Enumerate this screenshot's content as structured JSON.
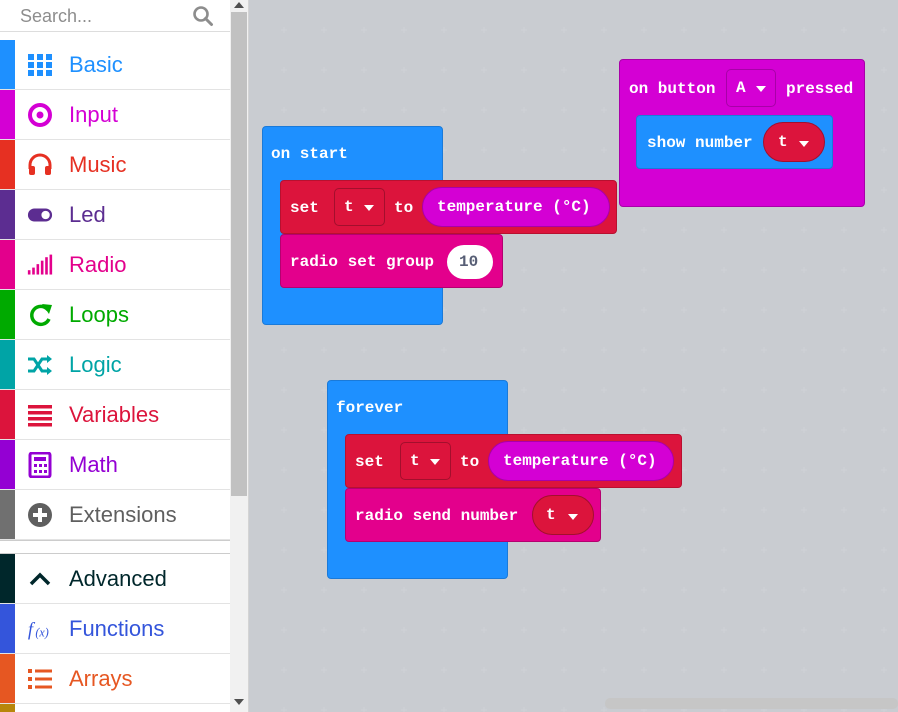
{
  "search": {
    "placeholder": "Search..."
  },
  "categories": [
    {
      "label": "Basic",
      "color": "#1e90ff",
      "icon": "grid-icon"
    },
    {
      "label": "Input",
      "color": "#d400d4",
      "icon": "target-icon"
    },
    {
      "label": "Music",
      "color": "#e63022",
      "icon": "headphones-icon"
    },
    {
      "label": "Led",
      "color": "#5c2d91",
      "icon": "toggle-icon"
    },
    {
      "label": "Radio",
      "color": "#e3008c",
      "icon": "signal-bars-icon"
    },
    {
      "label": "Loops",
      "color": "#00aa00",
      "icon": "refresh-icon"
    },
    {
      "label": "Logic",
      "color": "#00a4a6",
      "icon": "shuffle-icon"
    },
    {
      "label": "Variables",
      "color": "#dc143c",
      "icon": "lines-icon"
    },
    {
      "label": "Math",
      "color": "#9400d3",
      "icon": "calculator-icon"
    },
    {
      "label": "Extensions",
      "color": "#707070",
      "icon": "plus-circle-icon"
    }
  ],
  "advanced_categories": [
    {
      "label": "Advanced",
      "color": "#00272b",
      "icon": "chevron-up-icon"
    },
    {
      "label": "Functions",
      "color": "#3455db",
      "icon": "function-icon"
    },
    {
      "label": "Arrays",
      "color": "#e65722",
      "icon": "numbered-list-icon"
    }
  ],
  "blocks": {
    "on_start": {
      "label": "on start",
      "set_block": {
        "set": "set",
        "var": "t",
        "to": "to",
        "value": "temperature (°C)"
      },
      "group_block": {
        "label": "radio set group",
        "value": "10"
      }
    },
    "on_button": {
      "label_on": "on button",
      "button": "A",
      "label_pressed": "pressed",
      "show_block": {
        "label": "show number",
        "var": "t"
      }
    },
    "forever": {
      "label": "forever",
      "set_block": {
        "set": "set",
        "var": "t",
        "to": "to",
        "value": "temperature (°C)"
      },
      "send_block": {
        "label": "radio send number",
        "var": "t"
      }
    }
  }
}
